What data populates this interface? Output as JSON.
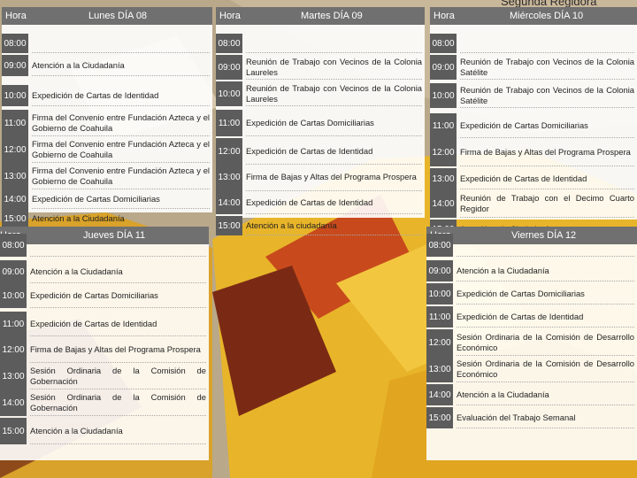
{
  "page_title": "Segunda Regidora",
  "column_header_time": "Hora",
  "days": [
    {
      "title": "Lunes DÍA 08",
      "rows": [
        {
          "time": "08:00",
          "text": ""
        },
        {
          "time": "09:00",
          "text": "Atención a la Ciudadanía"
        },
        {
          "time": "10:00",
          "text": "Expedición de Cartas de Identidad"
        },
        {
          "time": "11:00",
          "text": "Firma del Convenio entre Fundación Azteca y el Gobierno de Coahuila"
        },
        {
          "time": "12:00",
          "text": "Firma del Convenio entre Fundación Azteca y el Gobierno de Coahuila"
        },
        {
          "time": "13:00",
          "text": "Firma del Convenio entre Fundación Azteca y el Gobierno de Coahuila"
        },
        {
          "time": "14:00",
          "text": "Expedición de Cartas Domiciliarias"
        },
        {
          "time": "15:00",
          "text": "Atención a la Ciudadanía"
        }
      ]
    },
    {
      "title": "Martes DÍA 09",
      "rows": [
        {
          "time": "08:00",
          "text": ""
        },
        {
          "time": "09:00",
          "text": "Reunión de Trabajo con Vecinos de la Colonia Laureles"
        },
        {
          "time": "10:00",
          "text": "Reunión de Trabajo con Vecinos de la Colonia Laureles"
        },
        {
          "time": "11:00",
          "text": "Expedición de Cartas Domiciliarias"
        },
        {
          "time": "12:00",
          "text": "Expedición de Cartas de Identidad"
        },
        {
          "time": "13:00",
          "text": "Firma de Bajas y Altas del Programa Prospera"
        },
        {
          "time": "14:00",
          "text": "Expedición de Cartas de Identidad"
        },
        {
          "time": "15:00",
          "text": "Atención a la ciudadanía"
        }
      ]
    },
    {
      "title": "Miércoles DÍA 10",
      "rows": [
        {
          "time": "08:00",
          "text": ""
        },
        {
          "time": "09:00",
          "text": "Reunión de Trabajo con Vecinos de la Colonia Satélite"
        },
        {
          "time": "10:00",
          "text": "Reunión de Trabajo con Vecinos de la Colonia Satélite"
        },
        {
          "time": "11:00",
          "text": "Expedición de Cartas Domiciliarias"
        },
        {
          "time": "12:00",
          "text": "Firma de Bajas y Altas del Programa Prospera"
        },
        {
          "time": "13:00",
          "text": "Expedición de Cartas de Identidad"
        },
        {
          "time": "14:00",
          "text": "Reunión de Trabajo con el Decimo Cuarto Regidor"
        },
        {
          "time": "15:00",
          "text": "Atención a la Ciudadanía"
        }
      ]
    },
    {
      "title": "Jueves DÍA 11",
      "rows": [
        {
          "time": "08:00",
          "text": ""
        },
        {
          "time": "09:00",
          "text": "Atención a la Ciudadanía"
        },
        {
          "time": "10:00",
          "text": "Expedición de Cartas Domiciliarias"
        },
        {
          "time": "11:00",
          "text": "Expedición de Cartas de Identidad"
        },
        {
          "time": "12:00",
          "text": "Firma de Bajas y Altas del Programa Prospera"
        },
        {
          "time": "13:00",
          "text": "Sesión Ordinaria de la Comisión de Gobernación"
        },
        {
          "time": "14:00",
          "text": "Sesión Ordinaria de la Comisión de Gobernación"
        },
        {
          "time": "15:00",
          "text": "Atención a la Ciudadanía"
        }
      ]
    },
    {
      "title": "Viernes DÍA 12",
      "rows": [
        {
          "time": "08:00",
          "text": ""
        },
        {
          "time": "09:00",
          "text": "Atención a la Ciudadanía"
        },
        {
          "time": "10:00",
          "text": "Expedición de Cartas Domiciliarias"
        },
        {
          "time": "11:00",
          "text": "Expedición de Cartas de Identidad"
        },
        {
          "time": "12:00",
          "text": "Sesión Ordinaria de la Comisión de Desarrollo Económico"
        },
        {
          "time": "13:00",
          "text": "Sesión Ordinaria de la Comisión de Desarrollo Económico"
        },
        {
          "time": "14:00",
          "text": "Atención a la Ciudadanía"
        },
        {
          "time": "15:00",
          "text": "Evaluación del Trabajo Semanal"
        }
      ]
    }
  ],
  "colors": {
    "header_bg": "#707070",
    "time_bg": "#5c5c5c",
    "panel_bg": "#ffffff"
  }
}
